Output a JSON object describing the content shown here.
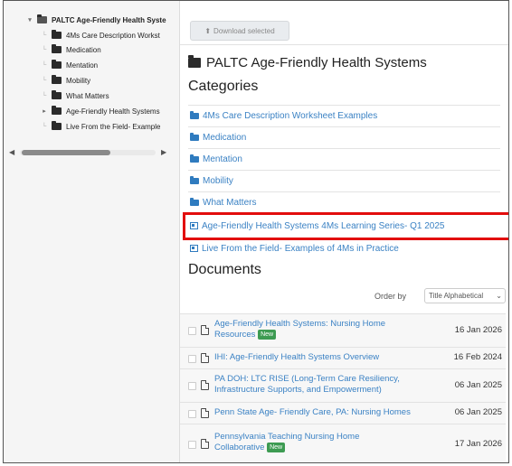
{
  "tree": {
    "items": [
      {
        "label": "PALTC Age-Friendly Health Syste",
        "toggle": "▾",
        "bold": true
      },
      {
        "label": "4Ms Care Description Workst",
        "toggle": "└"
      },
      {
        "label": "Medication",
        "toggle": "└"
      },
      {
        "label": "Mentation",
        "toggle": "└"
      },
      {
        "label": "Mobility",
        "toggle": "└"
      },
      {
        "label": "What Matters",
        "toggle": "└"
      },
      {
        "label": "Age-Friendly Health Systems",
        "toggle": "▸"
      },
      {
        "label": "Live From the Field- Example",
        "toggle": "└"
      }
    ]
  },
  "toolbar": {
    "download_label": "Download selected",
    "download_icon": "⬆"
  },
  "page": {
    "title": "PALTC Age-Friendly Health Systems",
    "categories_heading": "Categories",
    "documents_heading": "Documents"
  },
  "categories": [
    {
      "label": "4Ms Care Description Worksheet Examples",
      "icon": "folder-icon"
    },
    {
      "label": "Medication",
      "icon": "folder-icon"
    },
    {
      "label": "Mentation",
      "icon": "folder-icon"
    },
    {
      "label": "Mobility",
      "icon": "folder-icon"
    },
    {
      "label": "What Matters",
      "icon": "folder-icon"
    },
    {
      "label": "Age-Friendly Health Systems 4Ms Learning Series- Q1 2025",
      "icon": "subcategory-icon"
    },
    {
      "label": "Live From the Field- Examples of 4Ms in Practice",
      "icon": "subcategory-icon"
    }
  ],
  "order": {
    "label": "Order by",
    "selected": "Title Alphabetical"
  },
  "documents": [
    {
      "name": "Age-Friendly Health Systems: Nursing Home Resources",
      "badge": "New",
      "date": "16 Jan 2026"
    },
    {
      "name": "IHI: Age-Friendly Health Systems Overview",
      "badge": "",
      "date": "16 Feb 2024"
    },
    {
      "name": "PA DOH: LTC RISE (Long-Term Care Resiliency, Infrastructure Supports, and Empowerment)",
      "badge": "",
      "date": "06 Jan 2025"
    },
    {
      "name": "Penn State Age- Friendly Care, PA: Nursing Homes",
      "badge": "",
      "date": "06 Jan 2025"
    },
    {
      "name": "Pennsylvania Teaching Nursing Home Collaborative",
      "badge": "New",
      "date": "17 Jan 2026"
    }
  ],
  "colors": {
    "link": "#3b82c4",
    "highlight": "#e20d0d",
    "badge": "#3d9b52"
  }
}
